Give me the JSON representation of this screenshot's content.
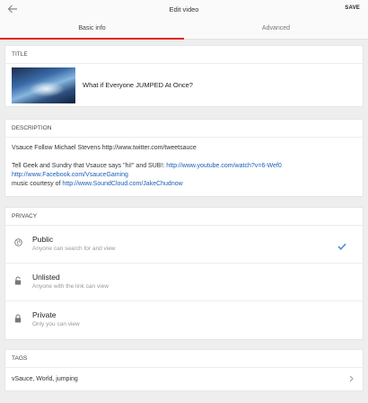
{
  "header": {
    "title": "Edit video",
    "save_label": "SAVE"
  },
  "tabs": [
    {
      "label": "Basic info",
      "active": true
    },
    {
      "label": "Advanced",
      "active": false
    }
  ],
  "title_section": {
    "header": "TITLE",
    "video_title": "What if Everyone JUMPED At Once?"
  },
  "description_section": {
    "header": "DESCRIPTION",
    "line1": "Vsauce Follow Michael Stevens http://www.twitter.com/tweetsauce",
    "line2_prefix": "Tell Geek and Sundry that Vsauce says \"hi!\" and SUB!: ",
    "link1": "http://www.youtube.com/watch?v=6-Wef0",
    "link2": "http://www.Facebook.com/VsauceGaming",
    "line4_prefix": "music courtesy of ",
    "link3": "http://www.SoundCloud.com/JakeChudnow"
  },
  "privacy_section": {
    "header": "PRIVACY",
    "options": [
      {
        "label": "Public",
        "sub": "Anyone can search for and view",
        "icon": "globe-icon",
        "selected": true
      },
      {
        "label": "Unlisted",
        "sub": "Anyone with the link can view",
        "icon": "unlock-icon",
        "selected": false
      },
      {
        "label": "Private",
        "sub": "Only you can view",
        "icon": "lock-icon",
        "selected": false
      }
    ]
  },
  "tags_section": {
    "header": "TAGS",
    "value": "vSauce, World, jumping"
  },
  "colors": {
    "accent_red": "#e62117",
    "link_blue": "#1a5fb4",
    "check_blue": "#4a90d9"
  }
}
